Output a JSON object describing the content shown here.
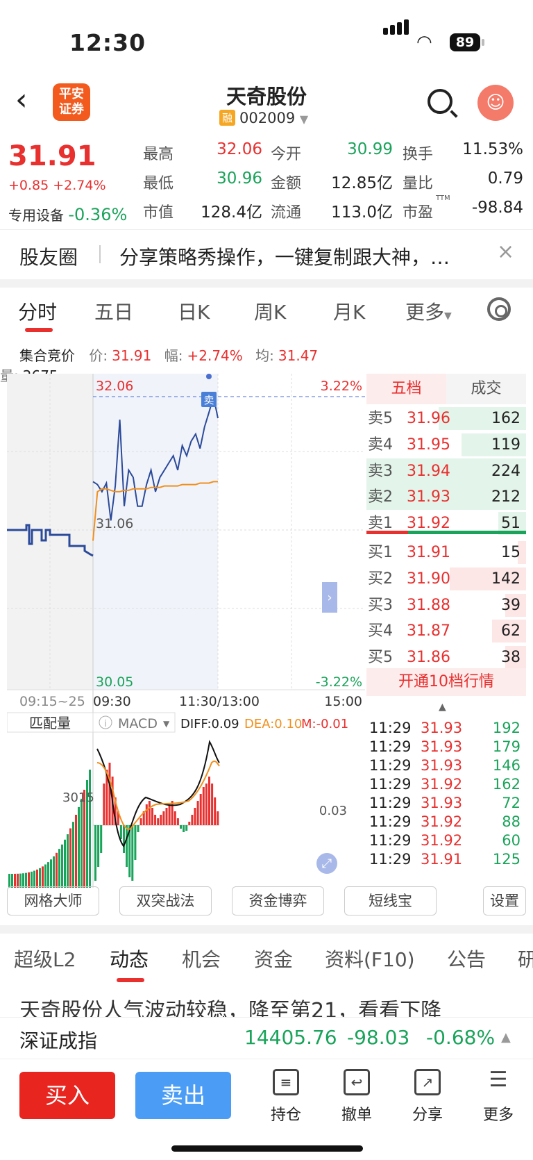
{
  "status": {
    "time": "12:30",
    "battery": "89"
  },
  "header": {
    "broker_logo": "平安\n证券",
    "title": "天奇股份",
    "margin_badge": "融",
    "code": "002009"
  },
  "quote": {
    "price": "31.91",
    "change": "+0.85 +2.74%",
    "sector_name": "专用设备",
    "sector_change": "-0.36%",
    "stats": [
      {
        "label": "最高",
        "value": "32.06",
        "color": "red"
      },
      {
        "label": "今开",
        "value": "30.99",
        "color": "green"
      },
      {
        "label": "换手",
        "value": "11.53%",
        "color": "black"
      },
      {
        "label": "最低",
        "value": "30.96",
        "color": "green"
      },
      {
        "label": "金额",
        "value": "12.85亿",
        "color": "black"
      },
      {
        "label": "量比",
        "value": "0.79",
        "color": "black"
      },
      {
        "label": "市值",
        "value": "128.4亿",
        "color": "black"
      },
      {
        "label": "流通",
        "value": "113.0亿",
        "color": "black"
      },
      {
        "label": "市盈",
        "value": "-98.84",
        "color": "black"
      }
    ],
    "ttm": "TTM"
  },
  "ad": {
    "title": "股友圈",
    "text": "分享策略秀操作，一键复制跟大神，…",
    "close": "×"
  },
  "chart_tabs": [
    "分时",
    "五日",
    "日K",
    "周K",
    "月K",
    "更多"
  ],
  "infobar": {
    "label": "集合竞价",
    "price_label": "价:",
    "price": "31.91",
    "amp_label": "幅:",
    "amp": "+2.74%",
    "avg_label": "均:",
    "avg": "31.47",
    "vol_label": "量:",
    "vol": "2675"
  },
  "chart_data": {
    "type": "line",
    "y_top": "32.06",
    "y_mid": "31.06",
    "y_bottom": "30.05",
    "pct_top": "3.22%",
    "pct_bottom": "-3.22%",
    "x_ticks": [
      "09:15~25",
      "09:30",
      "11:30/13:00",
      "15:00"
    ],
    "sell_marker": "卖",
    "sub_label": "匹配量",
    "sub_value": "3015",
    "macd_label": "MACD",
    "diff": "DIFF:0.09",
    "dea": "DEA:0.10",
    "m": "M:-0.01",
    "macd_scale": "0.03",
    "series": [
      {
        "name": "price",
        "values": [
          31.47,
          31.45,
          31.4,
          31.46,
          31.2,
          31.44,
          31.9,
          31.3,
          31.55,
          31.5,
          31.3,
          31.3,
          31.45,
          31.55,
          31.4,
          31.5,
          31.55,
          31.6,
          31.65,
          31.55,
          31.72,
          31.65,
          31.75,
          31.8,
          31.7,
          31.85,
          31.95,
          32.06,
          31.91
        ]
      },
      {
        "name": "avg",
        "values": [
          31.06,
          31.4,
          31.42,
          31.42,
          31.41,
          31.4,
          31.4,
          31.41,
          31.41,
          31.42,
          31.42,
          31.42,
          31.42,
          31.43,
          31.43,
          31.43,
          31.44,
          31.44,
          31.44,
          31.44,
          31.45,
          31.45,
          31.45,
          31.45,
          31.46,
          31.46,
          31.46,
          31.47,
          31.47
        ]
      }
    ]
  },
  "orderbook": {
    "tabs": [
      "五档",
      "成交"
    ],
    "asks": [
      {
        "label": "卖5",
        "price": "31.96",
        "vol": "162",
        "frac": 0.72
      },
      {
        "label": "卖4",
        "price": "31.95",
        "vol": "119",
        "frac": 0.53
      },
      {
        "label": "卖3",
        "price": "31.94",
        "vol": "224",
        "frac": 1.0
      },
      {
        "label": "卖2",
        "price": "31.93",
        "vol": "212",
        "frac": 0.95
      },
      {
        "label": "卖1",
        "price": "31.92",
        "vol": "51",
        "frac": 0.23
      }
    ],
    "bids": [
      {
        "label": "买1",
        "price": "31.91",
        "vol": "15",
        "frac": 0.07
      },
      {
        "label": "买2",
        "price": "31.90",
        "vol": "142",
        "frac": 0.63
      },
      {
        "label": "买3",
        "price": "31.88",
        "vol": "39",
        "frac": 0.17
      },
      {
        "label": "买4",
        "price": "31.87",
        "vol": "62",
        "frac": 0.28
      },
      {
        "label": "买5",
        "price": "31.86",
        "vol": "38",
        "frac": 0.17
      }
    ],
    "upgrade": "开通10档行情",
    "trades": [
      {
        "time": "11:29",
        "price": "31.93",
        "vol": "192"
      },
      {
        "time": "11:29",
        "price": "31.93",
        "vol": "179"
      },
      {
        "time": "11:29",
        "price": "31.93",
        "vol": "146"
      },
      {
        "time": "11:29",
        "price": "31.92",
        "vol": "162"
      },
      {
        "time": "11:29",
        "price": "31.93",
        "vol": "72"
      },
      {
        "time": "11:29",
        "price": "31.92",
        "vol": "88"
      },
      {
        "time": "11:29",
        "price": "31.92",
        "vol": "60"
      },
      {
        "time": "11:29",
        "price": "31.91",
        "vol": "125"
      }
    ]
  },
  "tools": [
    "网格大师",
    "双突战法",
    "资金博弈",
    "短线宝",
    "设置"
  ],
  "info_tabs": [
    "超级L2",
    "动态",
    "机会",
    "资金",
    "资料(F10)",
    "公告",
    "研"
  ],
  "news": "天奇股份人气波动较稳，降至第21，看看下降",
  "index": {
    "name": "深证成指",
    "value": "14405.76",
    "change": "-98.03",
    "pct": "-0.68%"
  },
  "bottom": {
    "buy": "买入",
    "sell": "卖出",
    "actions": [
      "持仓",
      "撤单",
      "分享",
      "更多"
    ]
  }
}
